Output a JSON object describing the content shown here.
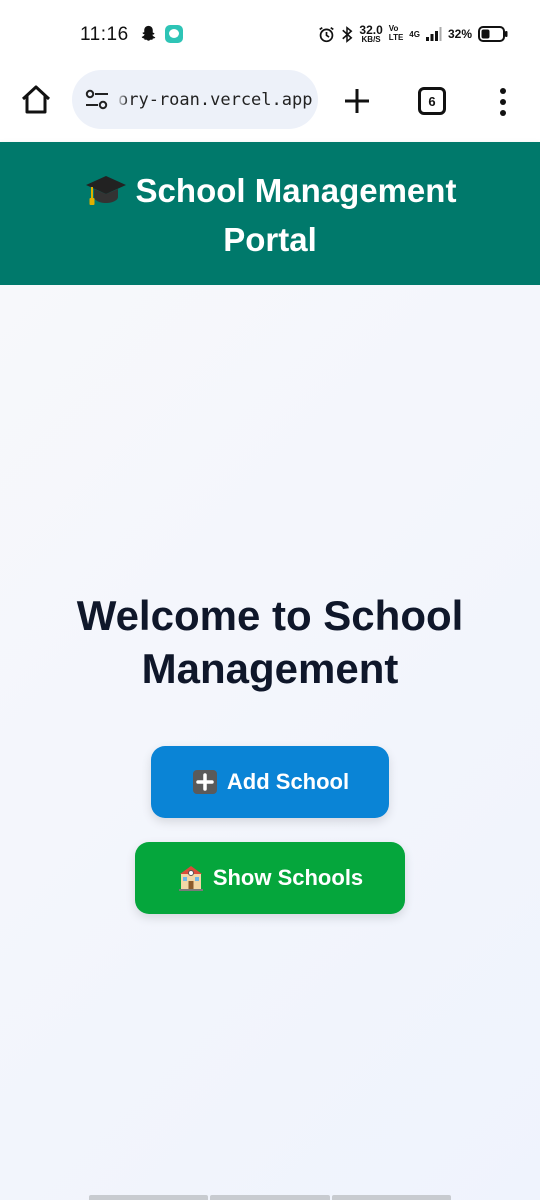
{
  "status_bar": {
    "time": "11:16",
    "speed_value": "32.0",
    "speed_unit": "KB/S",
    "volte_top": "Vo",
    "volte_bottom": "LTE",
    "network": "4G",
    "battery": "32%",
    "icons": [
      "snapchat-icon",
      "message-icon",
      "alarm-icon",
      "bluetooth-icon",
      "signal-icon",
      "battery-icon"
    ]
  },
  "browser": {
    "url": "ory-roan.vercel.app",
    "tab_count": "6",
    "icons": [
      "home-icon",
      "site-settings-icon",
      "plus-icon",
      "more-icon"
    ]
  },
  "header": {
    "title_line1": "School Management",
    "title_line2": "Portal",
    "icon": "graduation-cap-icon"
  },
  "main": {
    "welcome_line1": "Welcome to School",
    "welcome_line2": "Management",
    "add_button_label": "Add School",
    "show_button_label": "Show Schools"
  },
  "colors": {
    "header_bg": "#00796b",
    "add_button": "#0a84d6",
    "show_button": "#05a63c",
    "heading_text": "#0f172a"
  }
}
